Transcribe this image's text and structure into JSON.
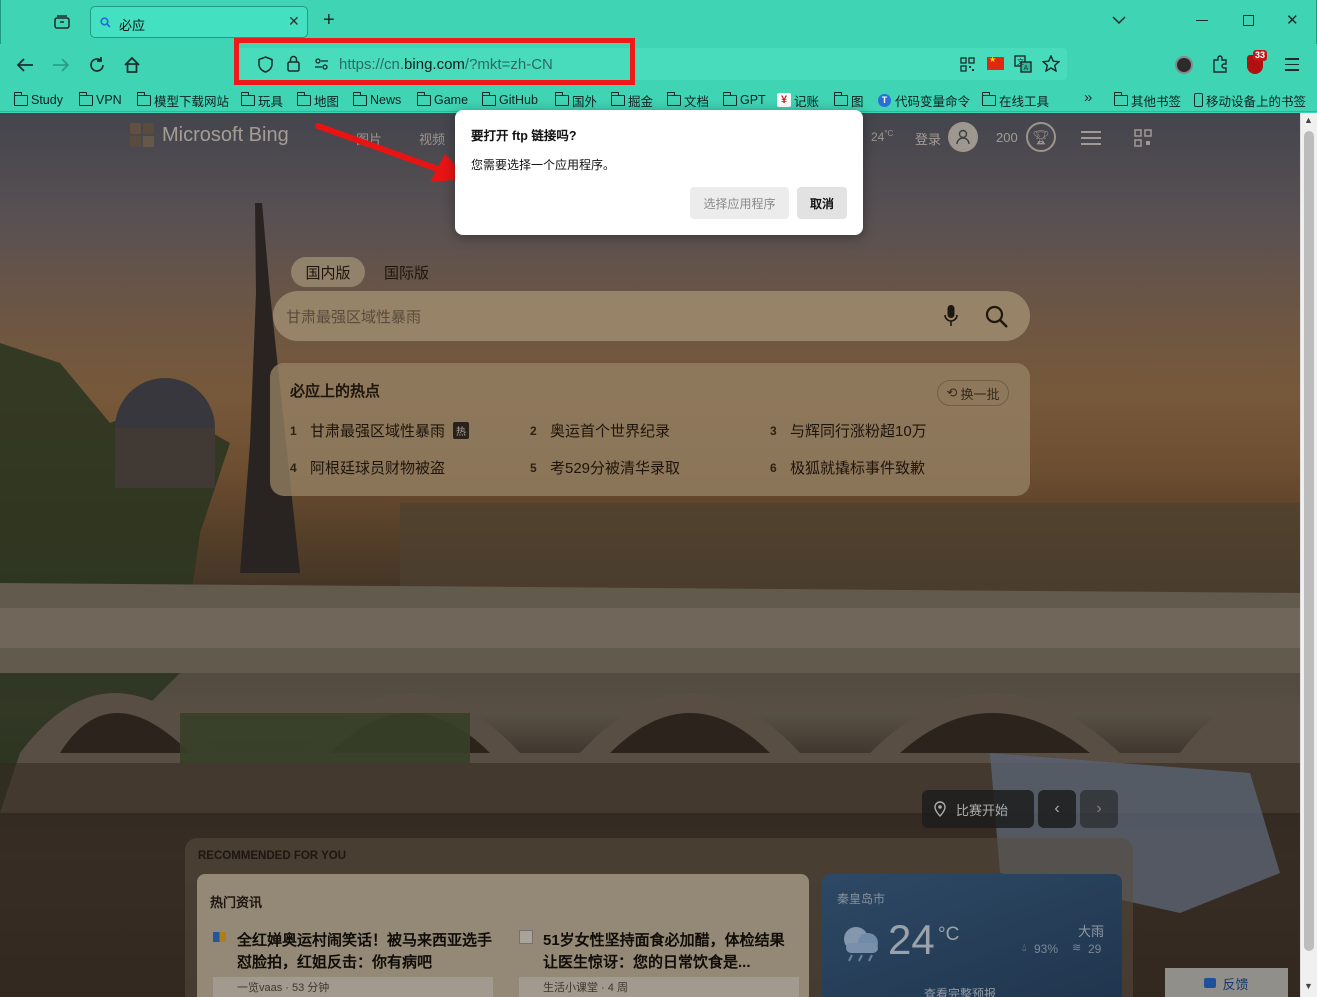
{
  "tabs": [
    {
      "title": "必应"
    }
  ],
  "address": {
    "url_prefix": "https://cn.",
    "url_domain": "bing.com",
    "url_suffix": "/?mkt=zh-CN"
  },
  "extensions": {
    "badge_count": "33"
  },
  "bookmarks": [
    {
      "label": "Study",
      "icon": "folder-icon"
    },
    {
      "label": "VPN",
      "icon": "folder-icon"
    },
    {
      "label": "模型下载网站",
      "icon": "folder-icon"
    },
    {
      "label": "玩具",
      "icon": "folder-icon"
    },
    {
      "label": "地图",
      "icon": "folder-icon"
    },
    {
      "label": "News",
      "icon": "folder-icon"
    },
    {
      "label": "Game",
      "icon": "folder-icon"
    },
    {
      "label": "GitHub",
      "icon": "folder-icon"
    },
    {
      "label": "国外",
      "icon": "folder-icon"
    },
    {
      "label": "掘金",
      "icon": "folder-icon"
    },
    {
      "label": "文档",
      "icon": "folder-icon"
    },
    {
      "label": "GPT",
      "icon": "folder-icon"
    },
    {
      "label": "记账",
      "icon": "yen-icon"
    },
    {
      "label": "图",
      "icon": "folder-icon"
    },
    {
      "label": "代码变量命令",
      "icon": "t-icon"
    },
    {
      "label": "在线工具",
      "icon": "folder-icon"
    }
  ],
  "bookmarks_right": [
    {
      "label": "其他书签"
    },
    {
      "label": "移动设备上的书签"
    }
  ],
  "bing": {
    "logo": "Microsoft Bing",
    "nav": [
      "图片",
      "视频"
    ],
    "temp": "24",
    "temp_unit": "°C",
    "login": "登录",
    "points": "200",
    "region_tabs": [
      "国内版",
      "国际版"
    ],
    "search_placeholder": "甘肃最强区域性暴雨",
    "hot_title": "必应上的热点",
    "refresh": "换一批",
    "hot_badge": "热",
    "hot_items": [
      {
        "n": "1",
        "text": "甘肃最强区域性暴雨"
      },
      {
        "n": "2",
        "text": "奥运首个世界纪录"
      },
      {
        "n": "3",
        "text": "与辉同行涨粉超10万"
      },
      {
        "n": "4",
        "text": "阿根廷球员财物被盗"
      },
      {
        "n": "5",
        "text": "考529分被清华录取"
      },
      {
        "n": "6",
        "text": "极狐就撬标事件致歉"
      }
    ],
    "game_btn": "比赛开始",
    "rec_title": "RECOMMENDED FOR YOU",
    "news_title": "热门资讯",
    "news": [
      {
        "title": "全红婵奥运村闹笑话！被马来西亚选手怼脸拍，红姐反击：你有病吧",
        "meta": "一览vaas · 53 分钟"
      },
      {
        "title": "51岁女性坚持面食必加醋，体检结果让医生惊讶：您的日常饮食是...",
        "meta": "生活小课堂 · 4 周"
      }
    ],
    "weather": {
      "city": "秦皇岛市",
      "temp": "24",
      "unit": "°C",
      "cond": "大雨",
      "humidity": "93%",
      "wind": "29",
      "more": "查看完整预报"
    },
    "feedback": "反馈"
  },
  "dialog": {
    "title": "要打开 ftp 链接吗?",
    "body": "您需要选择一个应用程序。",
    "choose_btn": "选择应用程序",
    "cancel_btn": "取消"
  }
}
